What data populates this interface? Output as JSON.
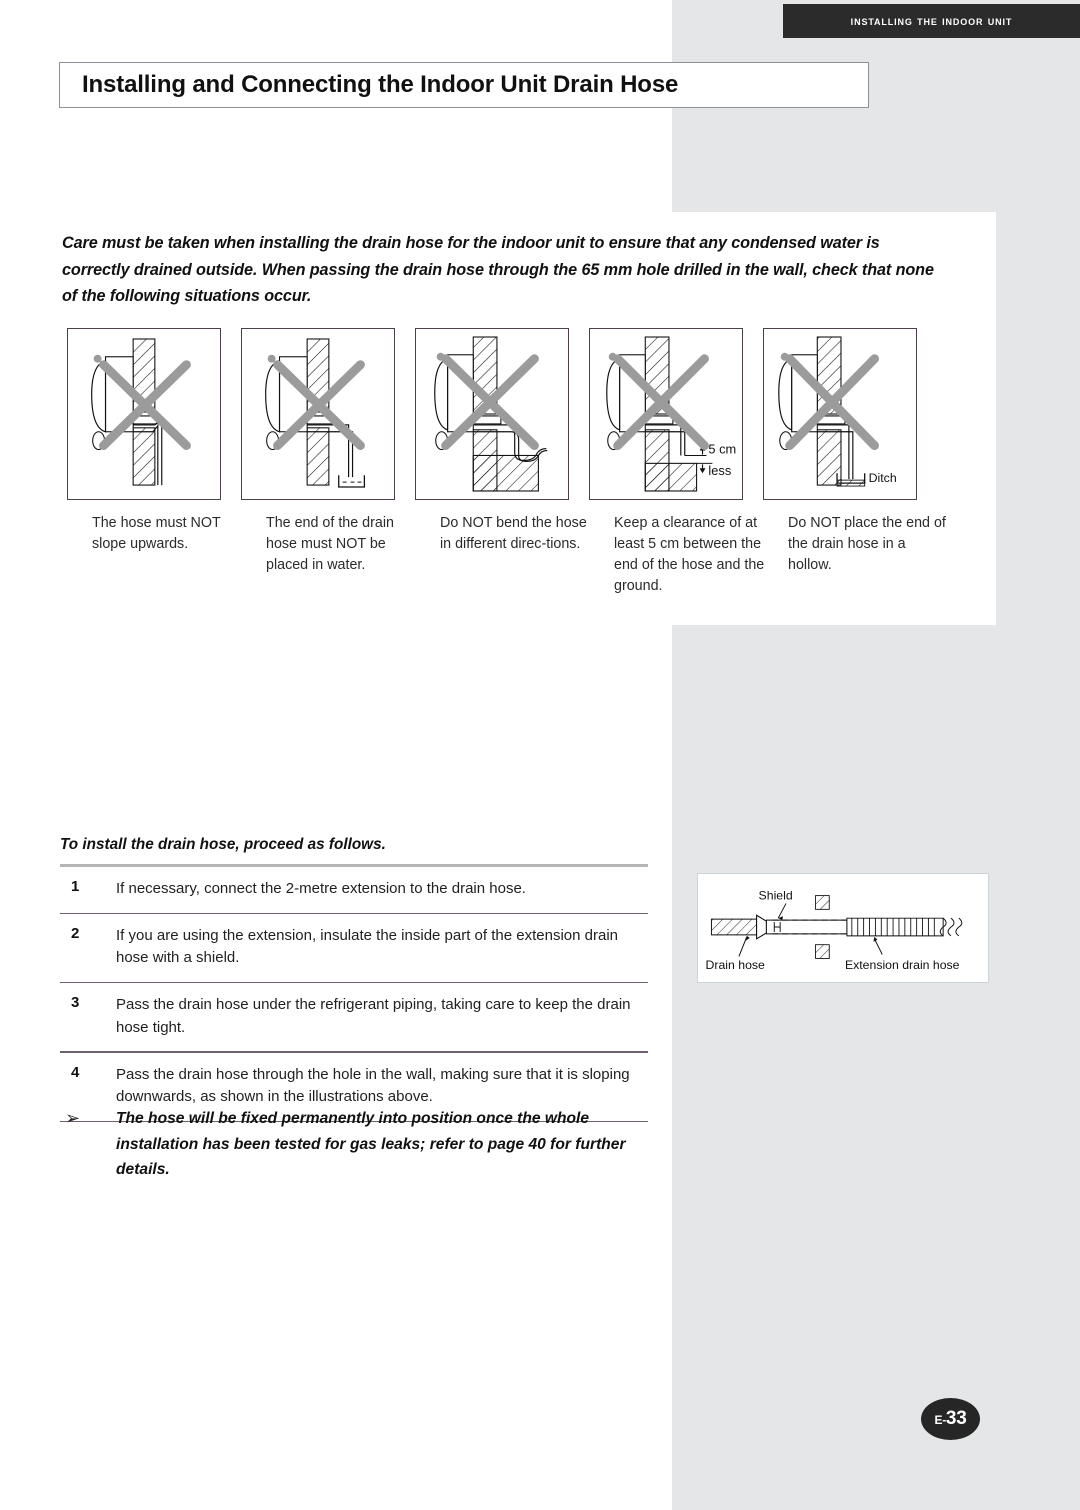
{
  "header": {
    "banner_text": "Installing the Indoor Unit"
  },
  "title": {
    "text": "Installing and Connecting the Indoor Unit Drain Hose"
  },
  "intro": {
    "text": "Care must be taken when installing the drain hose for the indoor unit to ensure that any condensed water is correctly drained outside. When passing the drain hose through the 65 mm hole drilled in the wall, check that none of the following situations occur."
  },
  "illustrations": {
    "panels": [
      {
        "name": "hose-slopes-upwards",
        "annotation": ""
      },
      {
        "name": "hose-end-in-water",
        "annotation": ""
      },
      {
        "name": "hose-bent-different-directions",
        "annotation": ""
      },
      {
        "name": "insufficient-ground-clearance",
        "annotation_top": "5 cm",
        "annotation_bottom": "less"
      },
      {
        "name": "hose-end-in-hollow",
        "annotation": "Ditch"
      }
    ],
    "captions": [
      "The hose must NOT slope upwards.",
      "The end of the drain hose must NOT be placed in water.",
      "Do NOT bend the hose in different direc-tions.",
      "Keep a clearance of at least 5 cm between the end of the hose and the ground.",
      "Do NOT place the end of the drain hose in a hollow."
    ]
  },
  "procedure": {
    "heading": "To install the drain hose, proceed as follows.",
    "steps": [
      {
        "num": "1",
        "text": "If necessary, connect the 2-metre extension to the drain hose."
      },
      {
        "num": "2",
        "text": "If you are using the extension, insulate the inside part of the extension drain hose with a shield."
      },
      {
        "num": "3",
        "text": "Pass the drain hose under the refrigerant piping, taking care to keep the drain hose tight."
      },
      {
        "num": "4",
        "text": "Pass the drain hose through the hole in the wall, making sure that it is sloping downwards, as shown in the illustrations above."
      }
    ],
    "note": {
      "bullet": "➢",
      "text": "The hose will be fixed permanently into position once the whole installation has been tested for gas leaks; refer to page 40 for further details."
    }
  },
  "extension_diagram": {
    "labels": {
      "shield": "Shield",
      "drain_hose": "Drain hose",
      "extension_drain_hose": "Extension drain hose"
    }
  },
  "footer": {
    "page_prefix": "E-",
    "page_number": "33"
  },
  "colors": {
    "banner_bg": "#2b2b2b",
    "page_bg_gray": "#e4e6e8",
    "panel_border": "#4a3f4a",
    "rule_top": "#b5b5b5",
    "rule": "#6d5f6d",
    "cross_mark": "#9b9b9b"
  }
}
